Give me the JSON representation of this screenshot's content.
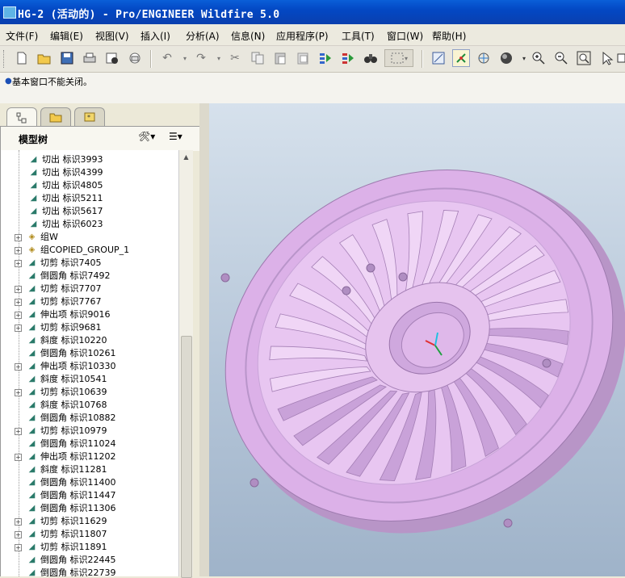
{
  "window": {
    "title": "HG-2 (活动的) - Pro/ENGINEER Wildfire 5.0"
  },
  "menu": [
    {
      "label": "文件(F)"
    },
    {
      "label": "编辑(E)"
    },
    {
      "label": "视图(V)"
    },
    {
      "label": "插入(I)"
    },
    {
      "label": "分析(A)"
    },
    {
      "label": "信息(N)"
    },
    {
      "label": "应用程序(P)"
    },
    {
      "label": "工具(T)"
    },
    {
      "label": "窗口(W)"
    },
    {
      "label": "帮助(H)"
    }
  ],
  "toolbar_icons": [
    "new-icon",
    "open-icon",
    "save-icon",
    "print-icon",
    "send-icon",
    "mail-icon",
    "undo-icon",
    "redo-icon",
    "cut-icon",
    "copy-icon",
    "paste-icon",
    "paste-special-icon",
    "regenerate-icon",
    "regenerate-manager-icon",
    "find-icon",
    "select-box-icon",
    "repaint-icon",
    "spin-center-icon",
    "orientation-icon",
    "shade-icon",
    "zoom-in-icon",
    "zoom-out-icon",
    "refit-icon",
    "pan-icon"
  ],
  "message": {
    "text": "基本窗口不能关闭。"
  },
  "model_tree": {
    "header": "模型树",
    "rows": [
      {
        "label": "切出 标识3993",
        "expand": "",
        "indent": 1
      },
      {
        "label": "切出 标识4399",
        "expand": "",
        "indent": 1
      },
      {
        "label": "切出 标识4805",
        "expand": "",
        "indent": 1
      },
      {
        "label": "切出 标识5211",
        "expand": "",
        "indent": 1
      },
      {
        "label": "切出 标识5617",
        "expand": "",
        "indent": 1
      },
      {
        "label": "切出 标识6023",
        "expand": "",
        "indent": 1
      },
      {
        "label": "组W",
        "expand": "+",
        "indent": 0
      },
      {
        "label": "组COPIED_GROUP_1",
        "expand": "+",
        "indent": 0
      },
      {
        "label": "切剪 标识7405",
        "expand": "+",
        "indent": 0
      },
      {
        "label": "倒圆角 标识7492",
        "expand": "",
        "indent": 0
      },
      {
        "label": "切剪 标识7707",
        "expand": "+",
        "indent": 0
      },
      {
        "label": "切剪 标识7767",
        "expand": "+",
        "indent": 0
      },
      {
        "label": "伸出项 标识9016",
        "expand": "+",
        "indent": 0
      },
      {
        "label": "切剪 标识9681",
        "expand": "+",
        "indent": 0
      },
      {
        "label": "斜度 标识10220",
        "expand": "",
        "indent": 0
      },
      {
        "label": "倒圆角 标识10261",
        "expand": "",
        "indent": 0
      },
      {
        "label": "伸出项 标识10330",
        "expand": "+",
        "indent": 0
      },
      {
        "label": "斜度 标识10541",
        "expand": "",
        "indent": 0
      },
      {
        "label": "切剪 标识10639",
        "expand": "+",
        "indent": 0
      },
      {
        "label": "斜度 标识10768",
        "expand": "",
        "indent": 0
      },
      {
        "label": "倒圆角 标识10882",
        "expand": "",
        "indent": 0
      },
      {
        "label": "切剪 标识10979",
        "expand": "+",
        "indent": 0
      },
      {
        "label": "倒圆角 标识11024",
        "expand": "",
        "indent": 0
      },
      {
        "label": "伸出项 标识11202",
        "expand": "+",
        "indent": 0
      },
      {
        "label": "斜度 标识11281",
        "expand": "",
        "indent": 0
      },
      {
        "label": "倒圆角 标识11400",
        "expand": "",
        "indent": 0
      },
      {
        "label": "倒圆角 标识11447",
        "expand": "",
        "indent": 0
      },
      {
        "label": "倒圆角 标识11306",
        "expand": "",
        "indent": 0
      },
      {
        "label": "切剪 标识11629",
        "expand": "+",
        "indent": 0
      },
      {
        "label": "切剪 标识11807",
        "expand": "+",
        "indent": 0
      },
      {
        "label": "切剪 标识11891",
        "expand": "+",
        "indent": 0
      },
      {
        "label": "倒圆角 标识22445",
        "expand": "",
        "indent": 0
      },
      {
        "label": "倒圆角 标识22739",
        "expand": "",
        "indent": 0
      }
    ]
  },
  "model": {
    "color": "#dcb1e8",
    "fin_count": 26
  }
}
